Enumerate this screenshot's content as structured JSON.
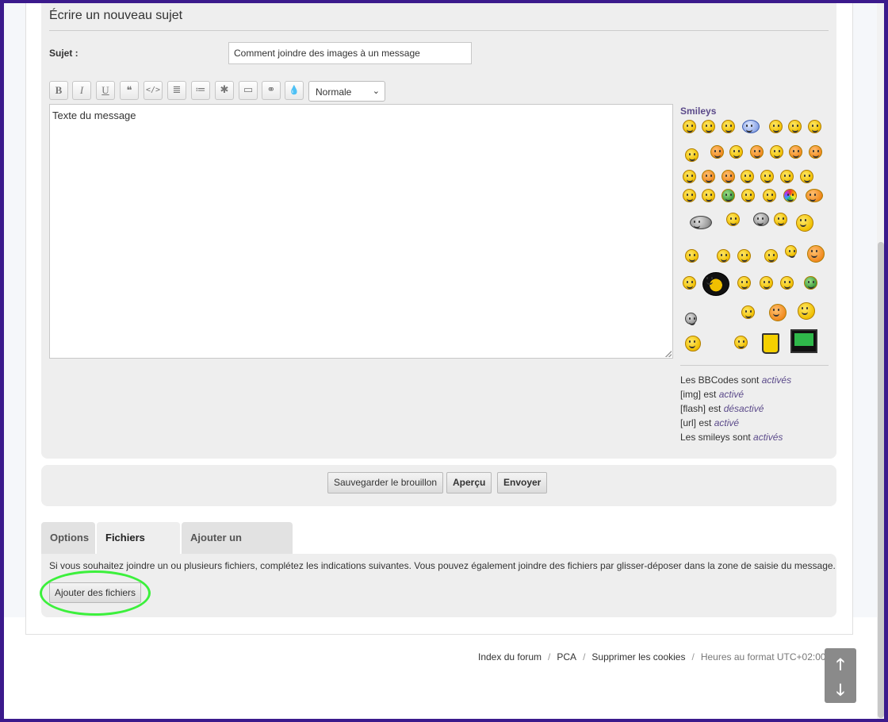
{
  "form": {
    "title": "Écrire un nouveau sujet",
    "subject_label": "Sujet :",
    "subject_value": "Comment joindre des images à un message",
    "message_value": "Texte du message"
  },
  "toolbar": {
    "buttons": [
      {
        "icon": "bold-icon",
        "glyph": "B"
      },
      {
        "icon": "italic-icon",
        "glyph": "I"
      },
      {
        "icon": "underline-icon",
        "glyph": "U"
      },
      {
        "icon": "quote-icon",
        "glyph": "❝"
      },
      {
        "icon": "code-icon",
        "glyph": "</>"
      },
      {
        "icon": "list-icon",
        "glyph": "≣"
      },
      {
        "icon": "ordered-list-icon",
        "glyph": "≔"
      },
      {
        "icon": "list-item-icon",
        "glyph": "✱"
      },
      {
        "icon": "image-icon",
        "glyph": "▭"
      },
      {
        "icon": "link-icon",
        "glyph": "⚭"
      },
      {
        "icon": "color-icon",
        "glyph": "💧"
      }
    ],
    "font_size_selected": "Normale"
  },
  "smileys": {
    "label": "Smileys"
  },
  "bbcode_status": {
    "line1_prefix": "Les BBCodes sont",
    "line1_state": "activés",
    "line2_prefix": "[img] est",
    "line2_state": "activé",
    "line3_prefix": "[flash] est",
    "line3_state": "désactivé",
    "line4_prefix": "[url] est",
    "line4_state": "activé",
    "line5_prefix": "Les smileys sont",
    "line5_state": "activés"
  },
  "actions": {
    "save_draft": "Sauvegarder le brouillon",
    "preview": "Aperçu",
    "submit": "Envoyer"
  },
  "tabs": {
    "options": "Options",
    "attachments": "Fichiers joints",
    "poll": "Ajouter un sondage"
  },
  "attachments": {
    "help_text": "Si vous souhaitez joindre un ou plusieurs fichiers, complétez les indications suivantes. Vous pouvez également joindre des fichiers par glisser-déposer dans la zone de saisie du message.",
    "add_button": "Ajouter des fichiers"
  },
  "footer": {
    "index": "Index du forum",
    "pca": "PCA",
    "cookies": "Supprimer les cookies",
    "timezone": "Heures au format UTC+02:00"
  },
  "scroll": {
    "up_glyph": "🡑",
    "down_glyph": "🡓"
  },
  "colors": {
    "frame": "#3b1a8c",
    "panel": "#eeeeee",
    "highlight": "#3cf03c",
    "accent_text": "#5b4a8a"
  }
}
